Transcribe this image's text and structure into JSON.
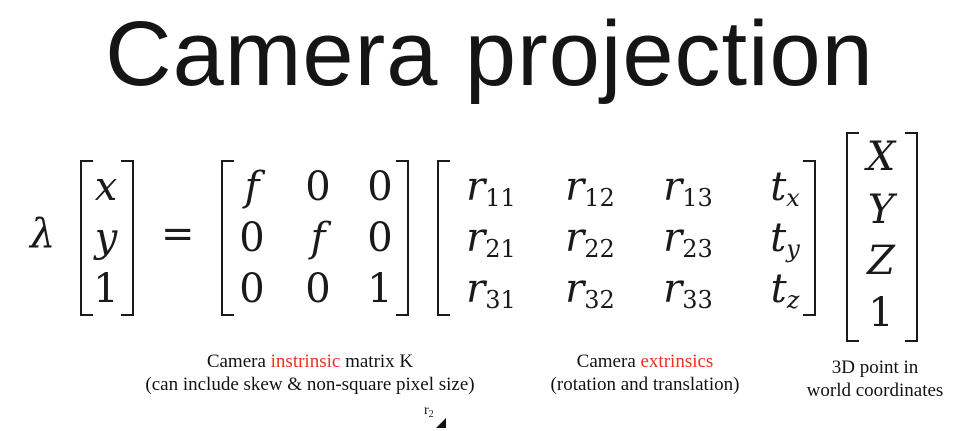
{
  "title": "Camera projection",
  "equation": {
    "lambda": "λ",
    "equals": "=",
    "image_vector": [
      "x",
      "y",
      "1"
    ],
    "intrinsic_matrix": [
      [
        "f",
        "0",
        "0"
      ],
      [
        "0",
        "f",
        "0"
      ],
      [
        "0",
        "0",
        "1"
      ]
    ],
    "extrinsic_matrix": [
      [
        {
          "base": "r",
          "sub": "11"
        },
        {
          "base": "r",
          "sub": "12"
        },
        {
          "base": "r",
          "sub": "13"
        },
        {
          "base": "t",
          "sub": "x"
        }
      ],
      [
        {
          "base": "r",
          "sub": "21"
        },
        {
          "base": "r",
          "sub": "22"
        },
        {
          "base": "r",
          "sub": "23"
        },
        {
          "base": "t",
          "sub": "y"
        }
      ],
      [
        {
          "base": "r",
          "sub": "31"
        },
        {
          "base": "r",
          "sub": "32"
        },
        {
          "base": "r",
          "sub": "33"
        },
        {
          "base": "t",
          "sub": "z"
        }
      ]
    ],
    "world_vector": [
      "X",
      "Y",
      "Z",
      "1"
    ]
  },
  "captions": {
    "intrinsic": {
      "pre": "Camera ",
      "highlight": "instrinsic",
      "post": " matrix K",
      "line2": "(can include skew & non-square pixel size)"
    },
    "extrinsic": {
      "pre": "Camera ",
      "highlight": "extrinsics",
      "line2": "(rotation and translation)"
    },
    "world": {
      "line1": "3D point in",
      "line2": "world coordinates"
    }
  },
  "cursor_label": {
    "base": "r",
    "sub": "2"
  },
  "colors": {
    "highlight": "#e8321e",
    "text": "#111111"
  }
}
